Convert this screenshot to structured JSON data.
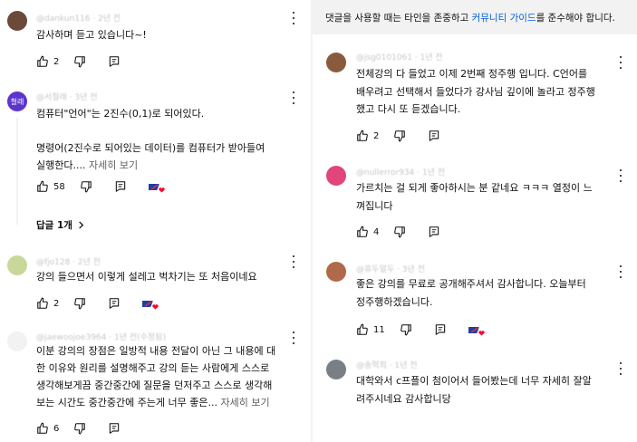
{
  "banner": {
    "prefix": "댓글을 사용할 때는 타인을 존중하고 ",
    "link": "커뮤니티 가이드",
    "suffix": "를 준수해야 합니다."
  },
  "left_comments": [
    {
      "author": "@dankun116 · 2년 전",
      "avatar_color": "#6b4a3a",
      "avatar_initial": "",
      "text": "감사하며 듣고 있습니다~!",
      "more": "",
      "likes": "2",
      "creator_heart": false
    },
    {
      "author": "@서철래 · 3년 전",
      "avatar_color": "#5c35cc",
      "avatar_initial": "철래",
      "text": "컴퓨터\"언어\"는 2진수(0,1)로 되어있다.\n\n명령어(2진수로 되어있는 데이터)를 컴퓨터가 받아들여\n실행한다.... ",
      "more": "자세히 보기",
      "likes": "58",
      "creator_heart": true,
      "replies_label": "답글 1개"
    },
    {
      "author": "@fjo128 · 2년 전",
      "avatar_color": "#c8d89a",
      "avatar_initial": "",
      "text": "강의 들으면서 이렇게 설레고 벅차기는 또 처음이네요",
      "more": "",
      "likes": "2",
      "creator_heart": true
    },
    {
      "author": "@jaewoojoe3964 · 1년 전(수정됨)",
      "avatar_color": "#f2f2f2",
      "avatar_initial": "",
      "text": "이분 강의의 장점은 일방적 내용 전달이 아닌 그 내용에 대\n한 이유와 원리를 설명해주고 강의 듣는 사람에게 스스로\n생각해보게끔 중간중간에 질문을 던저주고 스스로 생각해\n보는 시간도 중간중간에 주는게 너무 좋은... ",
      "more": "자세히 보기",
      "likes": "6",
      "creator_heart": false
    }
  ],
  "right_comments": [
    {
      "author": "@jsg0101061 · 1년 전",
      "avatar_color": "#8a5a3c",
      "avatar_initial": "",
      "text": "전체강의 다 들었고 이제 2번째 정주행 입니다. C언어를\n배우려고 선택해서 들었다가 강사님 깊이에 놀라고 정주행\n했고 다시 또 듣겠습니다.",
      "more": "",
      "likes": "2",
      "creator_heart": false
    },
    {
      "author": "@nullerror934 · 1년 전",
      "avatar_color": "#e0457b",
      "avatar_initial": "",
      "text": "가르치는 걸 되게 좋아하시는 분 같네요 ㅋㅋㅋ 열정이 느\n껴집니다",
      "more": "",
      "likes": "4",
      "creator_heart": false
    },
    {
      "author": "@휴두얼두 · 3년 전",
      "avatar_color": "#b06a4a",
      "avatar_initial": "",
      "text": "좋은 강의를 무료로 공개해주셔서 감사합니다. 오늘부터\n정주행하겠습니다.",
      "more": "",
      "likes": "11",
      "creator_heart": true
    },
    {
      "author": "@송혁희 · 1년 전",
      "avatar_color": "#7a7f86",
      "avatar_initial": "",
      "text": "대학와서 c프플이 첨이어서 들어봤는데 너무 자세히 잘알\n려주시네요 감사합니당",
      "more": "",
      "likes": "",
      "creator_heart": false
    }
  ]
}
